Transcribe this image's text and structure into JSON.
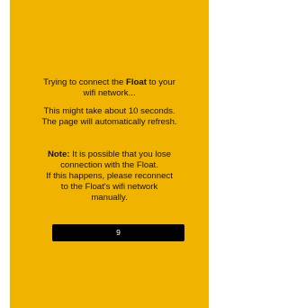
{
  "colors": {
    "panel_background": "#F0B400",
    "text": "#111111",
    "countdown_background": "#000000",
    "countdown_text": "#ffffff"
  },
  "connecting": {
    "prefix": "Trying to connect the ",
    "device_name": "Float",
    "suffix_line1": " to your",
    "line2": "wifi network..."
  },
  "wait": {
    "line1": "This might take about 10 seconds.",
    "line2": "The page will automatically refresh."
  },
  "note": {
    "label": "Note:",
    "line1_rest": " It is possible that you lose",
    "line2": "connection with the Float.",
    "line3": "If this happens, please reconnect",
    "line4": "to the Float's wifi network",
    "line5": "manually."
  },
  "countdown": {
    "value": "9"
  }
}
